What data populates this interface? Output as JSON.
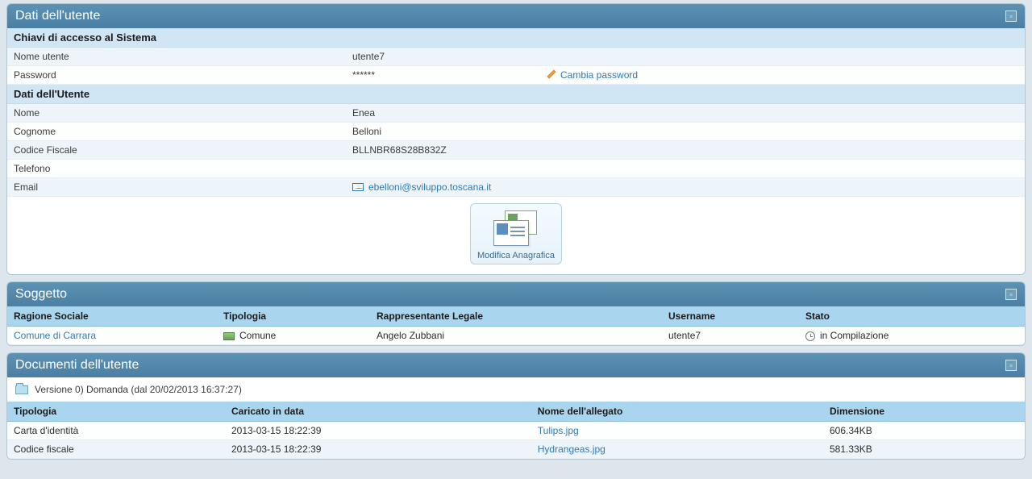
{
  "user_panel": {
    "title": "Dati dell'utente",
    "access_section": {
      "header": "Chiavi di accesso al Sistema",
      "username_label": "Nome utente",
      "username_value": "utente7",
      "password_label": "Password",
      "password_value": "******",
      "change_password_link": "Cambia password"
    },
    "details_section": {
      "header": "Dati dell'Utente",
      "name_label": "Nome",
      "name_value": "Enea",
      "surname_label": "Cognome",
      "surname_value": "Belloni",
      "fiscal_label": "Codice Fiscale",
      "fiscal_value": "BLLNBR68S28B832Z",
      "phone_label": "Telefono",
      "phone_value": "",
      "email_label": "Email",
      "email_value": "ebelloni@sviluppo.toscana.it"
    },
    "modify_button_label": "Modifica Anagrafica"
  },
  "subject_panel": {
    "title": "Soggetto",
    "columns": {
      "ragione": "Ragione Sociale",
      "tipologia": "Tipologia",
      "rappresentante": "Rappresentante Legale",
      "username": "Username",
      "stato": "Stato"
    },
    "row": {
      "ragione": "Comune di Carrara",
      "tipologia": "Comune",
      "rappresentante": "Angelo Zubbani",
      "username": "utente7",
      "stato": "in Compilazione"
    }
  },
  "documents_panel": {
    "title": "Documenti dell'utente",
    "version_row": "Versione 0) Domanda (dal 20/02/2013 16:37:27)",
    "columns": {
      "tipologia": "Tipologia",
      "caricato": "Caricato in data",
      "nome": "Nome dell'allegato",
      "dimensione": "Dimensione"
    },
    "rows": [
      {
        "tipologia": "Carta d'identità",
        "caricato": "2013-03-15 18:22:39",
        "nome": "Tulips.jpg",
        "dimensione": "606.34KB"
      },
      {
        "tipologia": "Codice fiscale",
        "caricato": "2013-03-15 18:22:39",
        "nome": "Hydrangeas.jpg",
        "dimensione": "581.33KB"
      }
    ]
  }
}
